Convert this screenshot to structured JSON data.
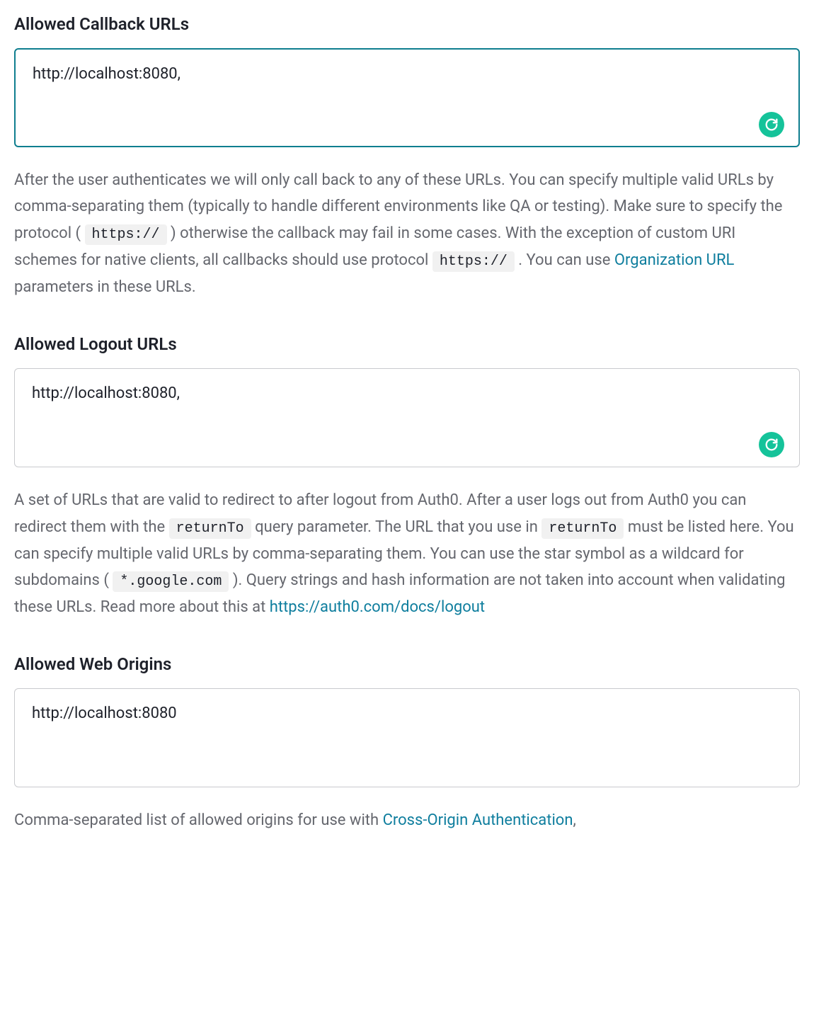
{
  "fields": {
    "callback": {
      "label": "Allowed Callback URLs",
      "value": "http://localhost:8080,",
      "focused": true,
      "has_grammarly": true,
      "help": {
        "pre1": "After the user authenticates we will only call back to any of these URLs. You can specify multiple valid URLs by comma-separating them (typically to handle different environments like QA or testing). Make sure to specify the protocol ( ",
        "code1": "https://",
        "mid1": " ) otherwise the callback may fail in some cases. With the exception of custom URI schemes for native clients, all callbacks should use protocol ",
        "code2": "https://",
        "mid2": " . You can use ",
        "link1": "Organization URL",
        "post1": " parameters in these URLs."
      }
    },
    "logout": {
      "label": "Allowed Logout URLs",
      "value": "http://localhost:8080,",
      "focused": false,
      "has_grammarly": true,
      "help": {
        "pre1": "A set of URLs that are valid to redirect to after logout from Auth0. After a user logs out from Auth0 you can redirect them with the ",
        "code1": "returnTo",
        "mid1": " query parameter. The URL that you use in ",
        "code2": "returnTo",
        "mid2": " must be listed here. You can specify multiple valid URLs by comma-separating them. You can use the star symbol as a wildcard for subdomains ( ",
        "code3": "*.google.com",
        "mid3": " ). Query strings and hash information are not taken into account when validating these URLs. Read more about this at ",
        "link1": "https://auth0.com/docs/logout"
      }
    },
    "origins": {
      "label": "Allowed Web Origins",
      "value": "http://localhost:8080",
      "focused": false,
      "has_grammarly": false,
      "help": {
        "pre1": "Comma-separated list of allowed origins for use with ",
        "link1": "Cross-Origin Authentication",
        "post1": ","
      }
    }
  }
}
